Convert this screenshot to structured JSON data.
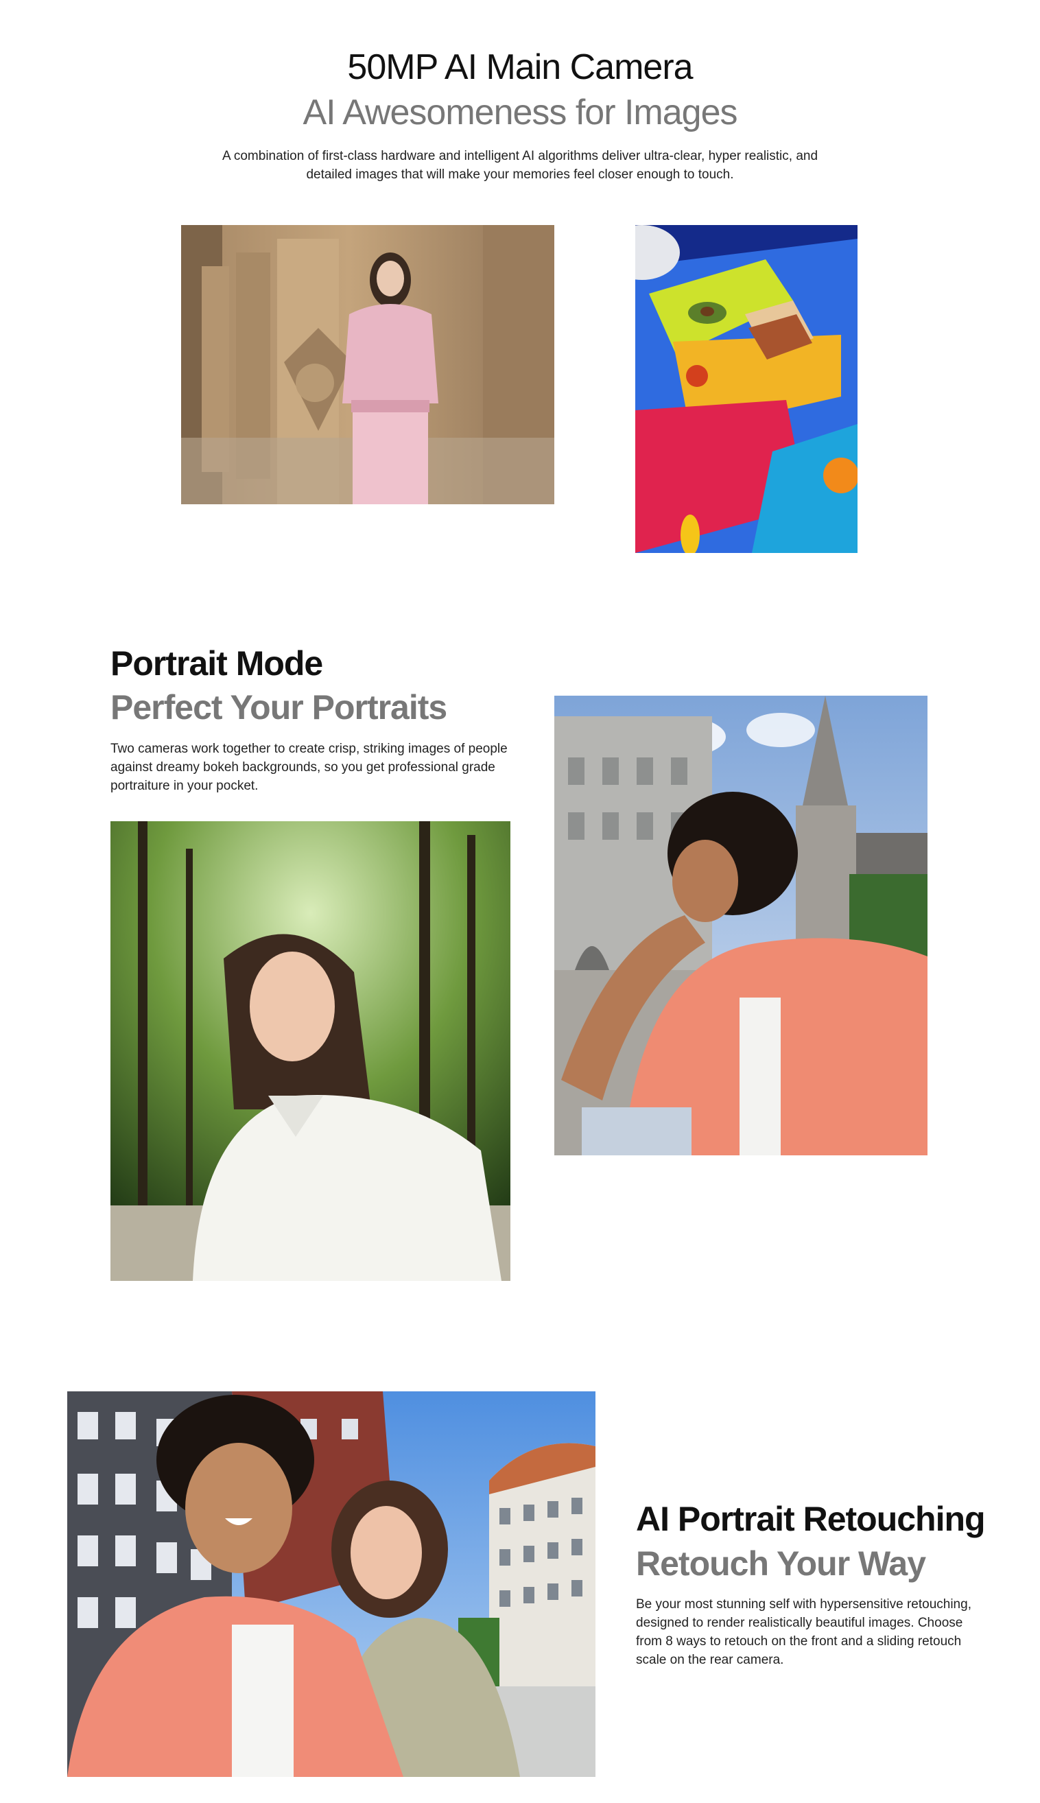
{
  "camera_section": {
    "title": "50MP AI Main Camera",
    "subtitle": "AI Awesomeness for Images",
    "description": "A combination of first-class hardware and intelligent AI algorithms deliver ultra-clear, hyper realistic, and detailed images that will make your memories feel closer enough to touch."
  },
  "portrait_section": {
    "title": "Portrait Mode",
    "subtitle": "Perfect Your Portraits",
    "description": "Two cameras work together to create crisp, striking images of people against dreamy bokeh backgrounds, so you get professional grade portraiture in your pocket."
  },
  "retouch_section": {
    "title": "AI Portrait Retouching",
    "subtitle": "Retouch Your Way",
    "description": "Be your most stunning self with hypersensitive retouching, designed to render realistically beautiful images. Choose from 8 ways to retouch on the front and a sliding retouch scale on the rear camera."
  },
  "colors": {
    "heading": "#111111",
    "subheading": "#777777",
    "background": "#ffffff"
  }
}
